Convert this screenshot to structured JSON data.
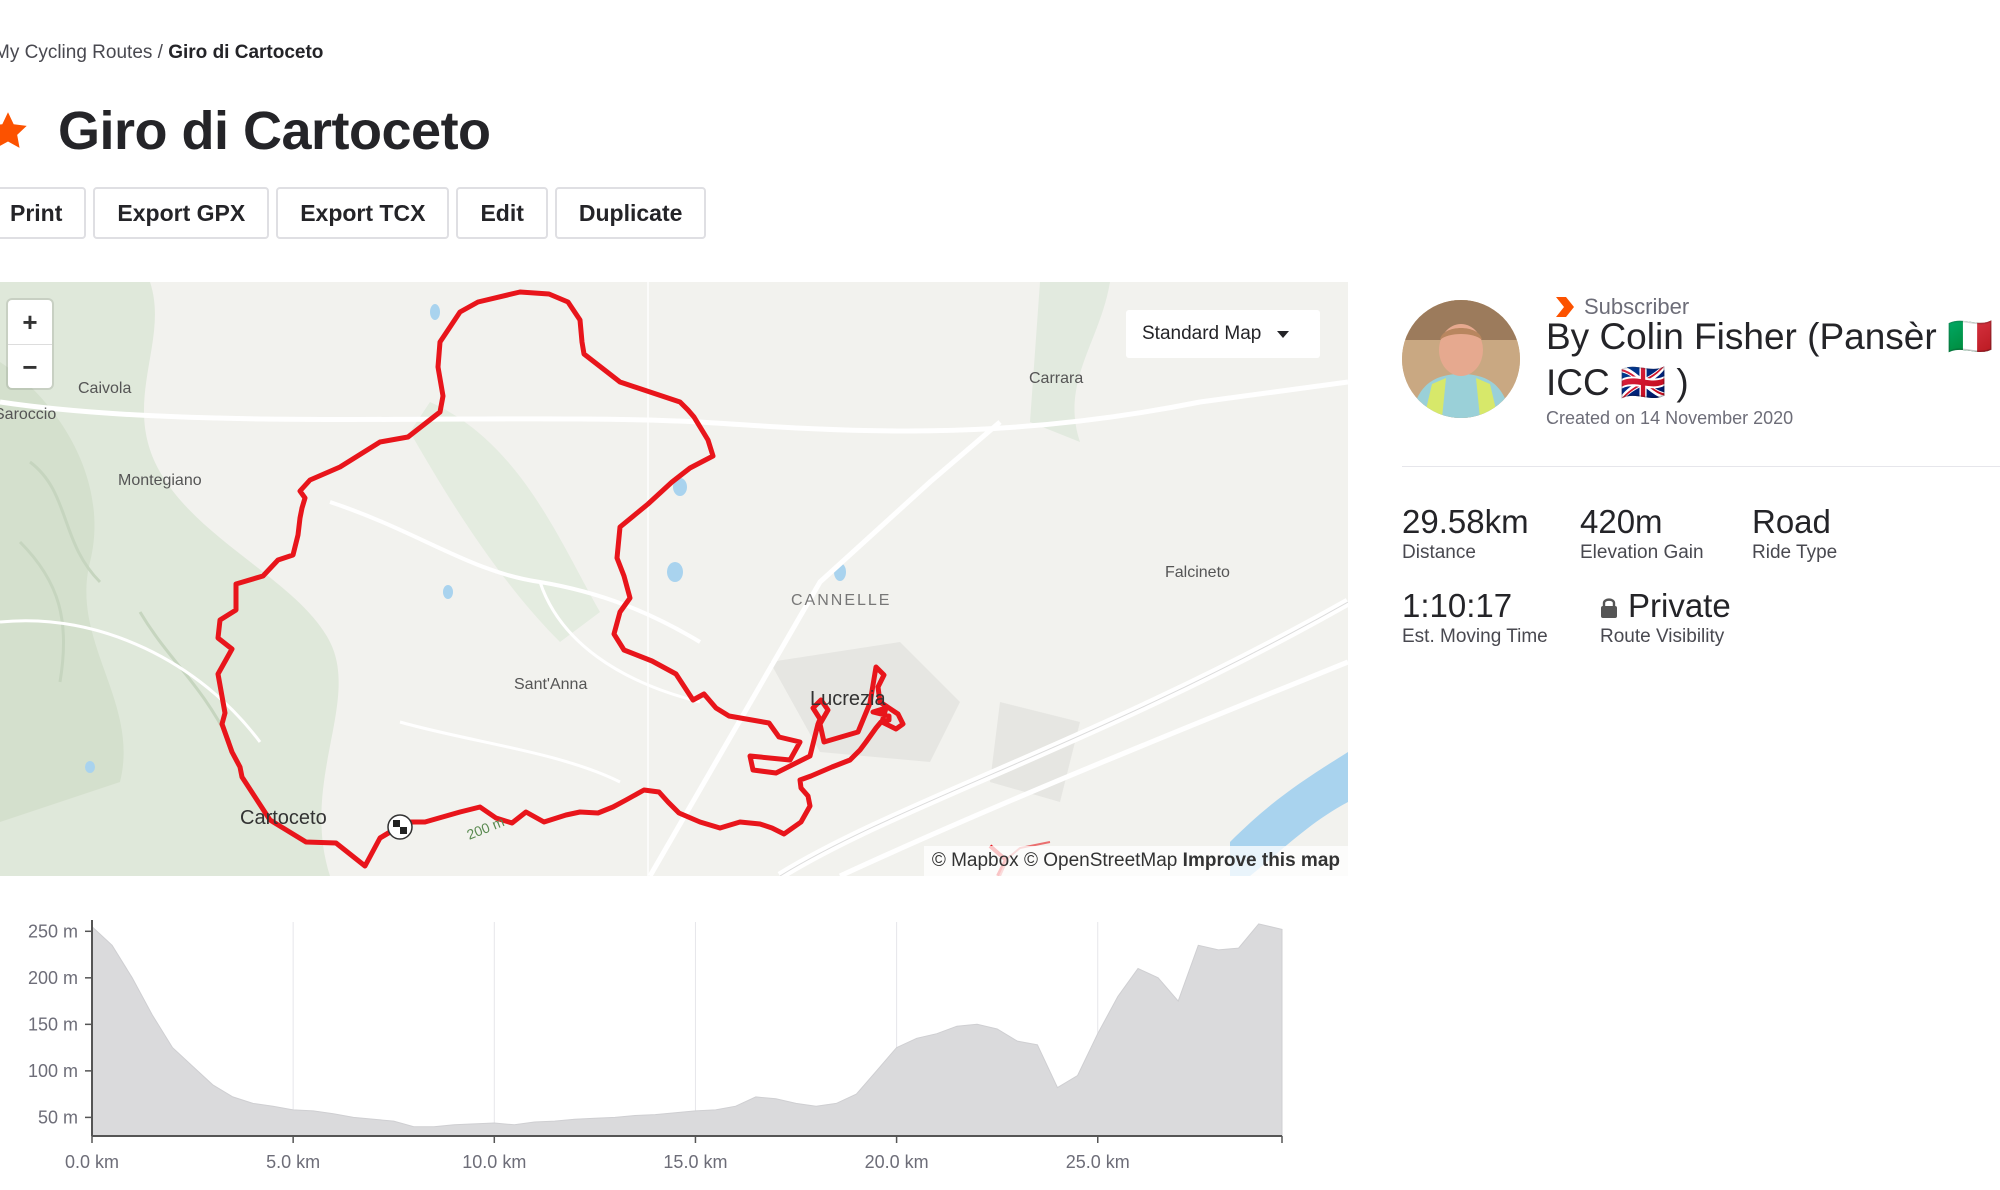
{
  "breadcrumb": {
    "parent": "My Cycling Routes",
    "separator": "/",
    "current": "Giro di Cartoceto"
  },
  "title": "Giro di Cartoceto",
  "actions": [
    "Print",
    "Export GPX",
    "Export TCX",
    "Edit",
    "Duplicate"
  ],
  "map": {
    "zoom_in": "+",
    "zoom_out": "−",
    "style_selector": "Standard Map",
    "places": {
      "caivola": "Caivola",
      "saroccio": "Saroccio",
      "montegiano": "Montegiano",
      "carrara": "Carrara",
      "cannelle": "CANNELLE",
      "falcineto": "Falcineto",
      "santanna": "Sant'Anna",
      "lucrezia": "Lucrezia",
      "cartoceto": "Cartoceto",
      "contour": "200 m"
    },
    "attribution": {
      "mapbox": "© Mapbox",
      "osm": "© OpenStreetMap",
      "improve": "Improve this map"
    },
    "colors": {
      "route": "#e8151b",
      "land": "#f2f2ee",
      "forest": "#dfe8da",
      "water": "#a9d3ee",
      "accent": "#fc5200"
    }
  },
  "owner": {
    "badge": "Subscriber",
    "name": "By Colin Fisher (Pansèr 🇮🇹 ICC 🇬🇧 )",
    "created": "Created on 14 November 2020"
  },
  "stats": {
    "distance": {
      "value": "29.58km",
      "label": "Distance"
    },
    "elevation": {
      "value": "420m",
      "label": "Elevation Gain"
    },
    "ride_type": {
      "value": "Road",
      "label": "Ride Type"
    },
    "moving_time": {
      "value": "1:10:17",
      "label": "Est. Moving Time"
    },
    "visibility": {
      "value": "Private",
      "label": "Route Visibility"
    }
  },
  "chart_data": {
    "type": "area",
    "title": "",
    "xlabel": "",
    "ylabel": "",
    "x_ticks": [
      "0.0 km",
      "5.0 km",
      "10.0 km",
      "15.0 km",
      "20.0 km",
      "25.0 km"
    ],
    "y_ticks": [
      "250 m",
      "200 m",
      "150 m",
      "100 m",
      "50 m"
    ],
    "xlim": [
      0,
      29.58
    ],
    "ylim": [
      30,
      260
    ],
    "grid": true,
    "series": [
      {
        "x": [
          0,
          0.5,
          1,
          1.5,
          2,
          2.5,
          3,
          3.5,
          4,
          4.5,
          5,
          5.5,
          6,
          6.5,
          7,
          7.5,
          8,
          8.5,
          9,
          9.5,
          10,
          10.5,
          11,
          11.5,
          12,
          12.5,
          13,
          13.5,
          14,
          14.5,
          15,
          15.5,
          16,
          16.5,
          17,
          17.5,
          18,
          18.5,
          19,
          19.5,
          20,
          20.5,
          21,
          21.5,
          22,
          22.5,
          23,
          23.5,
          24,
          24.5,
          25,
          25.5,
          26,
          26.5,
          27,
          27.5,
          28,
          28.5,
          29,
          29.58
        ],
        "values": [
          255,
          235,
          200,
          160,
          125,
          105,
          85,
          72,
          65,
          62,
          58,
          57,
          54,
          50,
          48,
          46,
          40,
          40,
          42,
          43,
          44,
          42,
          45,
          46,
          48,
          49,
          50,
          52,
          53,
          55,
          57,
          58,
          62,
          72,
          70,
          65,
          62,
          65,
          75,
          100,
          125,
          135,
          140,
          148,
          150,
          145,
          132,
          128,
          82,
          95,
          140,
          180,
          210,
          200,
          175,
          235,
          230,
          232,
          258,
          252
        ]
      }
    ]
  }
}
